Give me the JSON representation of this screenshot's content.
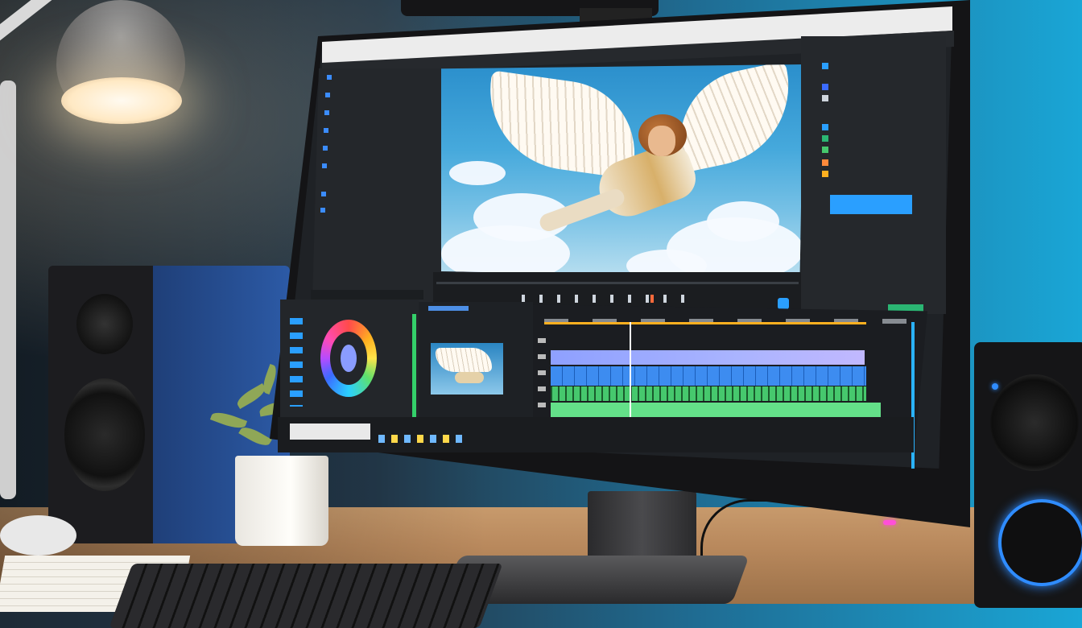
{
  "scene": {
    "description_tags": [
      "desk-lamp",
      "bookshelf-speaker-left",
      "bookshelf-speaker-right",
      "monitor",
      "potted-plant",
      "keyboard",
      "notepad",
      "webcam"
    ]
  },
  "colors": {
    "wall_left": "#243a4c",
    "wall_right": "#1aa6d6",
    "desk": "#b9895d",
    "accent_blue": "#2a9fff",
    "accent_green": "#2bb673",
    "timeline_purple": "#aab4ff",
    "timeline_blue": "#3d8cf0",
    "timeline_green": "#64e089",
    "playhead": "#ffffff",
    "led_pink": "#ff4fd8"
  },
  "icons": {
    "lamp": "desk-lamp-icon",
    "color_wheel": "color-wheel-icon"
  },
  "monitor": {
    "brand": "",
    "screen": {
      "app": "video-editor",
      "bezel_icons": ""
    }
  }
}
